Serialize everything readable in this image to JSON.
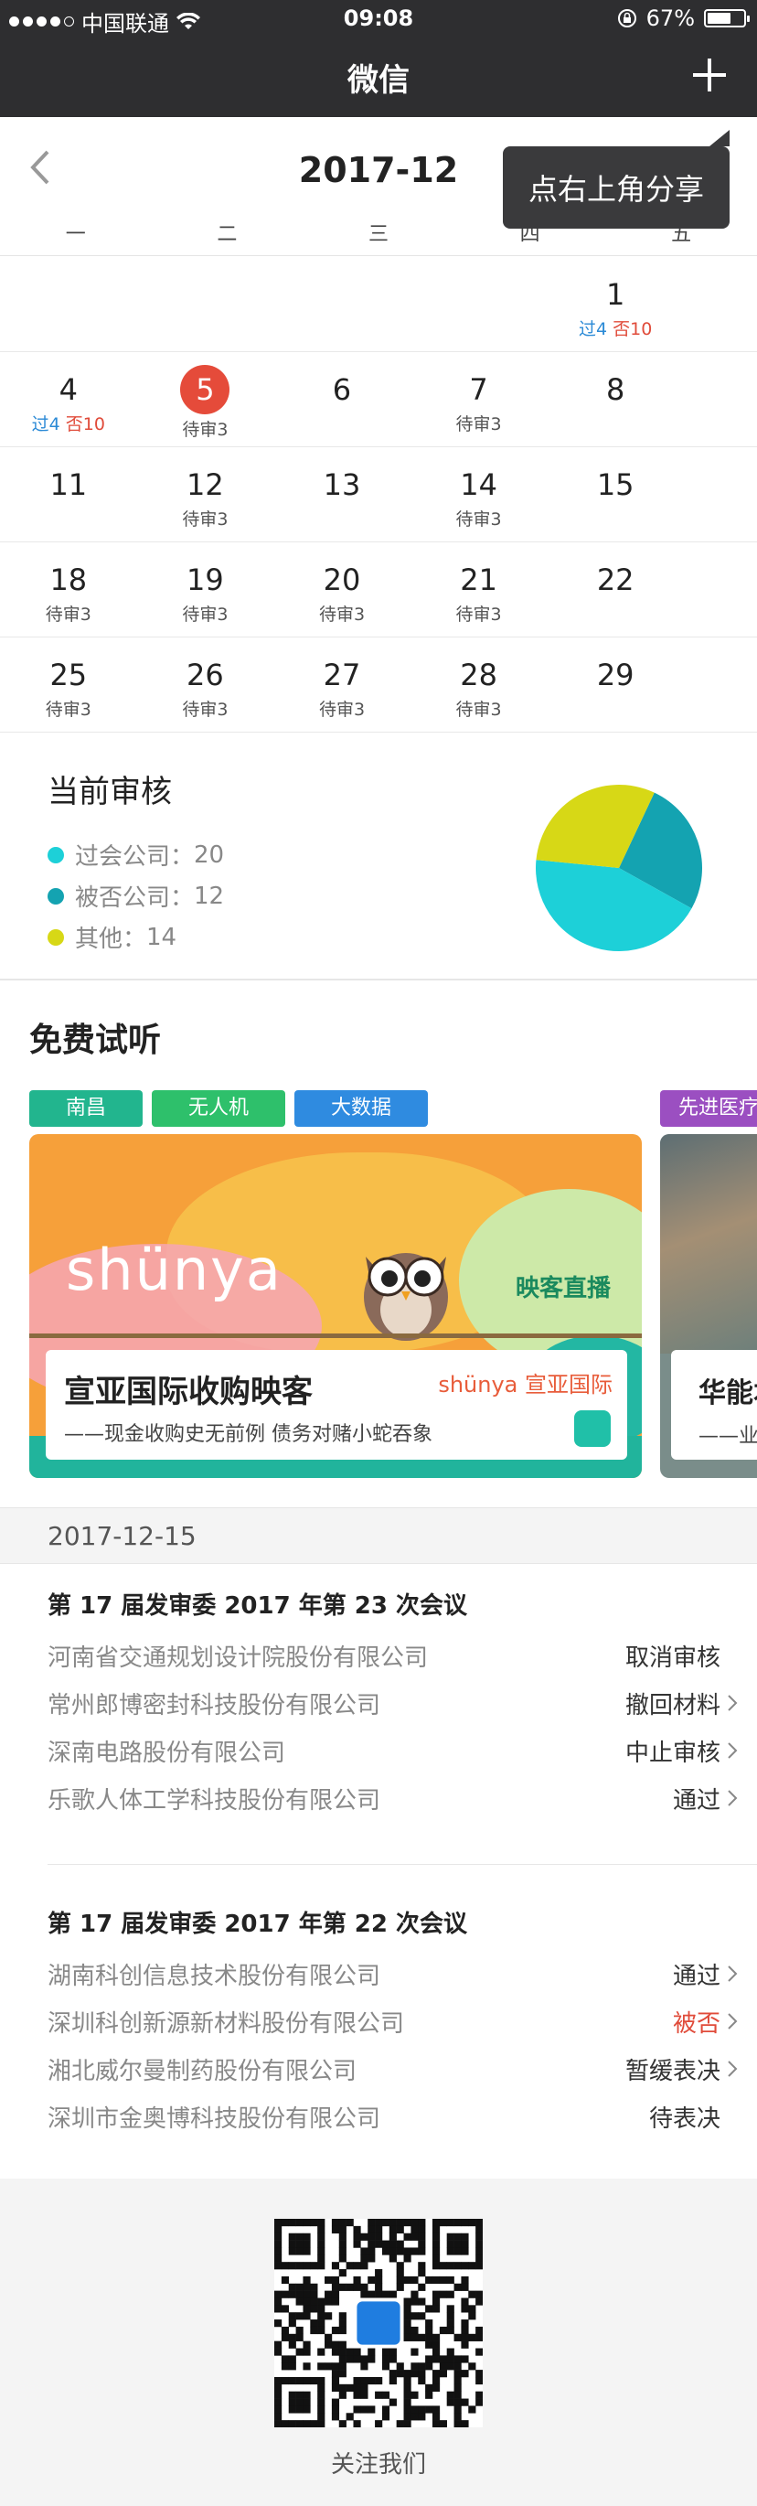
{
  "status_bar": {
    "carrier": "中国联通",
    "time": "09:08",
    "battery": "67%",
    "battery_level": 0.67
  },
  "nav": {
    "title": "微信",
    "plus_icon": "plus-icon"
  },
  "calendar": {
    "month": "2017-12",
    "weekdays": [
      "一",
      "二",
      "三",
      "四",
      "五",
      "",
      ""
    ],
    "tooltip": "点右上角分享",
    "weeks": [
      [
        {
          "day": "",
          "sub": ""
        },
        {
          "day": "",
          "sub": ""
        },
        {
          "day": "",
          "sub": ""
        },
        {
          "day": "",
          "sub": ""
        },
        {
          "day": "1",
          "pass": "过4",
          "deny": "否10"
        }
      ],
      [
        {
          "day": "4",
          "pass": "过4",
          "deny": "否10"
        },
        {
          "day": "5",
          "sub": "待审3",
          "today": true
        },
        {
          "day": "6",
          "sub": ""
        },
        {
          "day": "7",
          "sub": "待审3"
        },
        {
          "day": "8",
          "sub": ""
        }
      ],
      [
        {
          "day": "11",
          "sub": ""
        },
        {
          "day": "12",
          "sub": "待审3"
        },
        {
          "day": "13",
          "sub": ""
        },
        {
          "day": "14",
          "sub": "待审3"
        },
        {
          "day": "15",
          "sub": ""
        }
      ],
      [
        {
          "day": "18",
          "sub": "待审3"
        },
        {
          "day": "19",
          "sub": "待审3"
        },
        {
          "day": "20",
          "sub": "待审3"
        },
        {
          "day": "21",
          "sub": "待审3"
        },
        {
          "day": "22",
          "sub": ""
        }
      ],
      [
        {
          "day": "25",
          "sub": "待审3"
        },
        {
          "day": "26",
          "sub": "待审3"
        },
        {
          "day": "27",
          "sub": "待审3"
        },
        {
          "day": "28",
          "sub": "待审3"
        },
        {
          "day": "29",
          "sub": ""
        }
      ]
    ]
  },
  "summary": {
    "title": "当前审核",
    "items": [
      {
        "label": "过会公司：",
        "value": "20",
        "color": "#1dd0d8"
      },
      {
        "label": "被否公司：",
        "value": "12",
        "color": "#14a3b1"
      },
      {
        "label": "其他：",
        "value": "14",
        "color": "#d7d816"
      }
    ]
  },
  "trial": {
    "title": "免费试听",
    "tags": [
      "南昌",
      "无人机",
      "大数据"
    ],
    "tag_right": "先进医疗",
    "card1": {
      "brand": "shünya",
      "brand_tag": "映客直播",
      "title": "宣亚国际收购映客",
      "subtitle": "——现金收购史无前例 债务对赌小蛇吞象",
      "logo": "shünya 宣亚国际"
    },
    "card2": {
      "title": "华能本",
      "subtitle": "——业绩"
    }
  },
  "date_bar": "2017-12-15",
  "meetings": [
    {
      "title": "第 17 届发审委 2017 年第 23 次会议",
      "rows": [
        {
          "company": "河南省交通规划设计院股份有限公司",
          "status": "取消审核",
          "chevron": false
        },
        {
          "company": "常州郎博密封科技股份有限公司",
          "status": "撤回材料",
          "chevron": true
        },
        {
          "company": "深南电路股份有限公司",
          "status": "中止审核",
          "chevron": true
        },
        {
          "company": "乐歌人体工学科技股份有限公司",
          "status": "通过",
          "chevron": true
        }
      ]
    },
    {
      "title": "第 17 届发审委 2017 年第 22 次会议",
      "rows": [
        {
          "company": "湖南科创信息技术股份有限公司",
          "status": "通过",
          "chevron": true
        },
        {
          "company": "深圳科创新源新材料股份有限公司",
          "status": "被否",
          "chevron": true,
          "red": true
        },
        {
          "company": "湘北威尔曼制药股份有限公司",
          "status": "暂缓表决",
          "chevron": true
        },
        {
          "company": "深圳市金奥博科技股份有限公司",
          "status": "待表决",
          "chevron": false
        }
      ]
    }
  ],
  "footer": {
    "label": "关注我们"
  }
}
